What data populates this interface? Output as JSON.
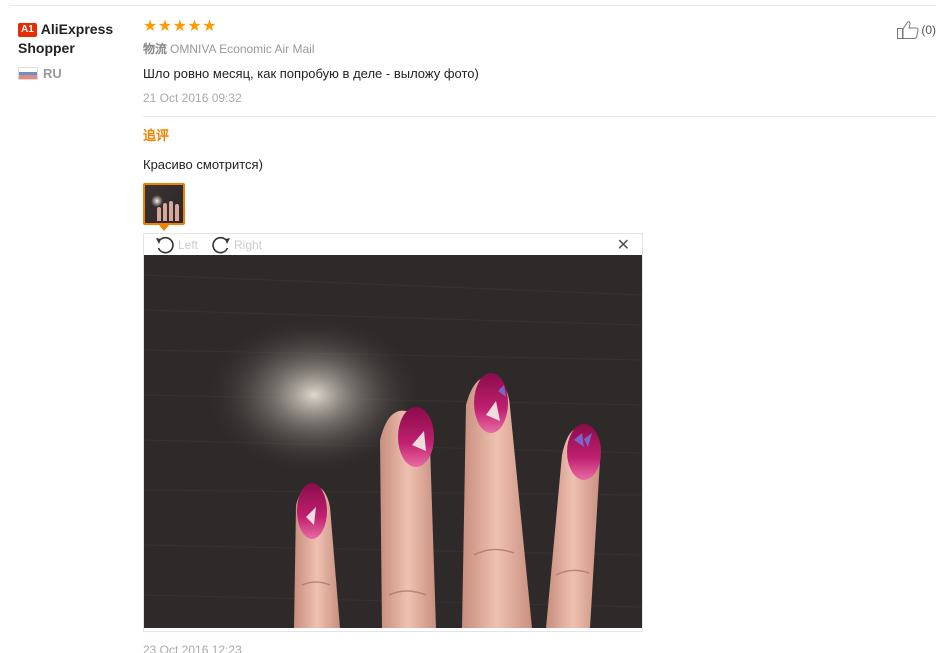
{
  "user": {
    "badge": "A1",
    "name": "AliExpress Shopper",
    "country": "RU",
    "flag_colors": [
      "#ffffff",
      "#1c57b9",
      "#d52b1e"
    ]
  },
  "feedback": {
    "rating": 5,
    "stars": [
      "★",
      "★",
      "★",
      "★",
      "★"
    ],
    "logistics_label": "物流",
    "logistics_value": "OMNIVA Economic Air Mail",
    "text": "Шло ровно месяц, как попробую в деле - выложу фото)",
    "date": "21 Oct 2016 09:32",
    "useful_count": "(0)"
  },
  "additional": {
    "title": "追评",
    "text": "Красиво смотрится)",
    "date": "23 Oct 2016 12:23"
  },
  "viewer": {
    "rotate_left_label": "Left",
    "rotate_right_label": "Right",
    "close_label": "✕"
  },
  "colors": {
    "accent": "#f08200",
    "star": "#ff9a00",
    "badge": "#e62e04",
    "muted": "#999999"
  }
}
